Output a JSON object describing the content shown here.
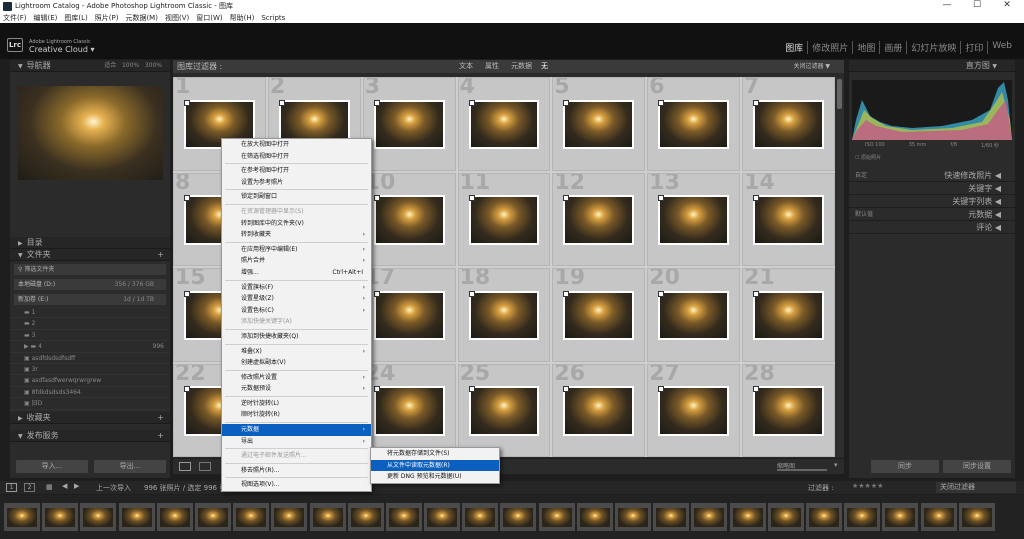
{
  "titlebar": {
    "title": "Lightroom Catalog - Adobe Photoshop Lightroom Classic - 图库",
    "minimize": "—",
    "maximize": "☐",
    "close": "✕"
  },
  "menu": [
    "文件(F)",
    "编辑(E)",
    "图库(L)",
    "照片(P)",
    "元数据(M)",
    "视图(V)",
    "窗口(W)",
    "帮助(H)",
    "Scripts"
  ],
  "brand": {
    "logo": "Lrc",
    "small": "Adobe Lightroom Classic",
    "big": "Creative Cloud"
  },
  "modules": [
    "图库",
    "修改照片",
    "地图",
    "画册",
    "幻灯片放映",
    "打印",
    "Web"
  ],
  "left": {
    "navigator": "导航器",
    "nav_zoom": [
      "适合",
      "100%",
      "300%"
    ],
    "catalog": "目录",
    "folders": "文件夹",
    "filter_folders": "筛选文件夹",
    "drive_c": "本地磁盘 (D:)",
    "drive_c_info": "356 / 376 GB",
    "drive_e": "新加卷 (E:)",
    "drive_e_info": "1d / 1d TB",
    "folder_items": [
      "1",
      "2",
      "3",
      "4",
      "asdfdsdsdfsdff",
      "3r",
      "asdfasdfwerwqrwrgrew",
      "8fdkdsdsds3464",
      "旧D"
    ],
    "folder_counts": [
      "",
      "",
      "",
      "996",
      "",
      "",
      "",
      "",
      ""
    ],
    "collections": "收藏夹",
    "publish": "发布服务",
    "import_btn": "导入...",
    "export_btn": "导出..."
  },
  "filter": {
    "title": "图库过滤器 :",
    "tabs": [
      "文本",
      "属性",
      "元数据",
      "无"
    ],
    "custom": "关闭过滤器 ▼"
  },
  "right": {
    "histogram": "直方图",
    "iso": "ISO 100",
    "focal": "35 mm",
    "aperture": "f/8",
    "shutter": "1/60 秒",
    "original": "原始照片",
    "quick_develop": "快速修改照片",
    "preset_label": "自定",
    "keywords": "关键字",
    "keyword_list": "关键字列表",
    "metadata": "元数据",
    "default_label": "默认值",
    "comments": "评论",
    "sync_btn": "同步",
    "sync_settings_btn": "同步设置"
  },
  "grid": {
    "numbers": [
      "1",
      "2",
      "3",
      "4",
      "5",
      "6",
      "7",
      "8",
      "9",
      "10",
      "11",
      "12",
      "13",
      "14",
      "15",
      "16",
      "17",
      "18",
      "19",
      "20",
      "21",
      "22",
      "23",
      "24",
      "25",
      "26",
      "27",
      "28"
    ]
  },
  "context_menu": {
    "items": [
      {
        "label": "在放大视图中打开",
        "arrow": ""
      },
      {
        "label": "在筛选视图中打开",
        "arrow": ""
      },
      {
        "sep": true
      },
      {
        "label": "在参考视图中打开",
        "arrow": ""
      },
      {
        "label": "设置为参考照片",
        "arrow": ""
      },
      {
        "sep": true
      },
      {
        "label": "锁定到副窗口",
        "arrow": ""
      },
      {
        "sep": true
      },
      {
        "label": "在资源管理器中显示(S)",
        "arrow": "",
        "dis": true
      },
      {
        "label": "转到图库中的文件夹(V)",
        "arrow": ""
      },
      {
        "label": "转到收藏夹",
        "arrow": "›"
      },
      {
        "sep": true
      },
      {
        "label": "在应用程序中编辑(E)",
        "arrow": "›"
      },
      {
        "label": "照片合并",
        "arrow": "›"
      },
      {
        "label": "增强...",
        "arrow": "",
        "sc": "Ctrl+Alt+I"
      },
      {
        "sep": true
      },
      {
        "label": "设置旗标(F)",
        "arrow": "›"
      },
      {
        "label": "设置星级(Z)",
        "arrow": "›"
      },
      {
        "label": "设置色标(C)",
        "arrow": "›"
      },
      {
        "label": "添加快捷关键字(A)",
        "arrow": "",
        "dis": true
      },
      {
        "sep": true
      },
      {
        "label": "添加到快捷收藏夹(Q)",
        "arrow": ""
      },
      {
        "sep": true
      },
      {
        "label": "堆叠(X)",
        "arrow": "›"
      },
      {
        "label": "创建虚拟副本(V)",
        "arrow": ""
      },
      {
        "sep": true
      },
      {
        "label": "修改照片设置",
        "arrow": "›"
      },
      {
        "label": "元数据预设",
        "arrow": "›"
      },
      {
        "sep": true
      },
      {
        "label": "逆时针旋转(L)",
        "arrow": ""
      },
      {
        "label": "顺时针旋转(R)",
        "arrow": ""
      },
      {
        "sep": true
      },
      {
        "label": "元数据",
        "arrow": "›",
        "hl": true
      },
      {
        "label": "导出",
        "arrow": "›"
      },
      {
        "sep": true
      },
      {
        "label": "通过电子邮件发送照片...",
        "arrow": "",
        "dis": true
      },
      {
        "sep": true
      },
      {
        "label": "移去照片(R)...",
        "arrow": ""
      },
      {
        "sep": true
      },
      {
        "label": "视图选项(V)...",
        "arrow": ""
      }
    ]
  },
  "submenu": {
    "items": [
      {
        "label": "将元数据存储到文件(S)"
      },
      {
        "label": "从文件中读取元数据(R)",
        "hl": true
      },
      {
        "label": "更新 DNG 预览和元数据(U)"
      }
    ]
  },
  "toolbar": {
    "sort": "缩略图"
  },
  "filmbar": {
    "prev": "上一次导入",
    "count": "996 张照片 / 选定 996 张",
    "filter": "过滤器 :",
    "filter_off": "关闭过滤器"
  },
  "filmstrip_count": 26
}
